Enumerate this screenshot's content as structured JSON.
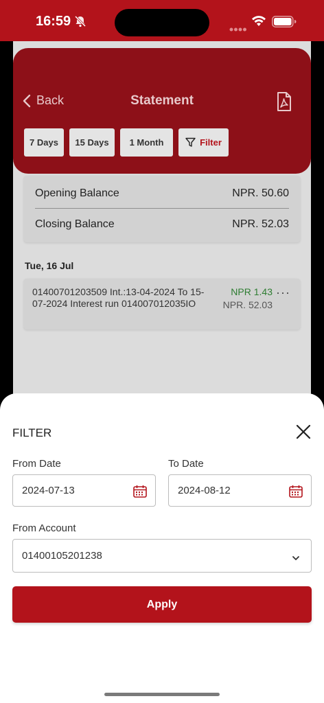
{
  "status_bar": {
    "time": "16:59"
  },
  "header": {
    "back_label": "Back",
    "title": "Statement"
  },
  "chips": [
    {
      "label": "7 Days"
    },
    {
      "label": "15 Days"
    },
    {
      "label": "1 Month"
    },
    {
      "label": "Filter"
    }
  ],
  "balances": {
    "opening_label": "Opening Balance",
    "opening_value": "NPR. 50.60",
    "closing_label": "Closing Balance",
    "closing_value": "NPR. 52.03"
  },
  "transactions": {
    "date": "Tue, 16 Jul",
    "items": [
      {
        "description": "01400701203509 Int.:13-04-2024 To 15-07-2024 Interest run 014007012035IO",
        "amount": "NPR 1.43",
        "balance": "NPR. 52.03",
        "more": "···"
      }
    ]
  },
  "filter": {
    "title": "FILTER",
    "from_date_label": "From Date",
    "from_date_value": "2024-07-13",
    "to_date_label": "To Date",
    "to_date_value": "2024-08-12",
    "account_label": "From Account",
    "account_value": "01400105201238",
    "apply_label": "Apply"
  },
  "colors": {
    "brand": "#b3131b",
    "credit": "#2e7d32"
  },
  "icons": [
    "bell-slash-icon",
    "signal-icon",
    "wifi-icon",
    "battery-icon",
    "chevron-left-icon",
    "pdf-icon",
    "filter-icon",
    "more-icon",
    "close-icon",
    "calendar-icon",
    "chevron-down-icon"
  ]
}
